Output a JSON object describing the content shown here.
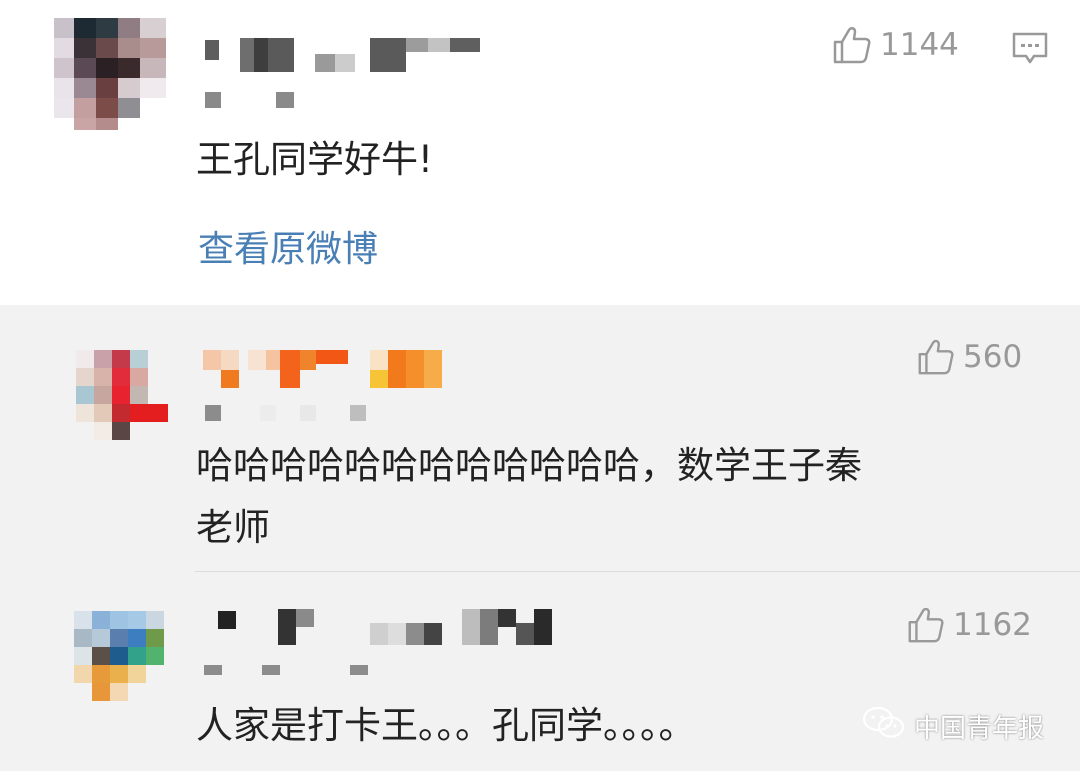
{
  "comments": [
    {
      "like_count": "1144",
      "text": "王孔同学好牛!",
      "link": "查看原微博"
    },
    {
      "like_count": "560",
      "text_line1": "哈哈哈哈哈哈哈哈哈哈哈哈，数学王子秦",
      "text_line2": "老师"
    },
    {
      "like_count": "1162",
      "text": "人家是打卡王。。。孔同学。。。。"
    }
  ],
  "watermark": {
    "text": "中国青年报",
    "icon": "wechat-icon"
  },
  "colors": {
    "link": "#4a7fb5",
    "meta": "#999999",
    "reply_bg": "#f2f2f2"
  }
}
